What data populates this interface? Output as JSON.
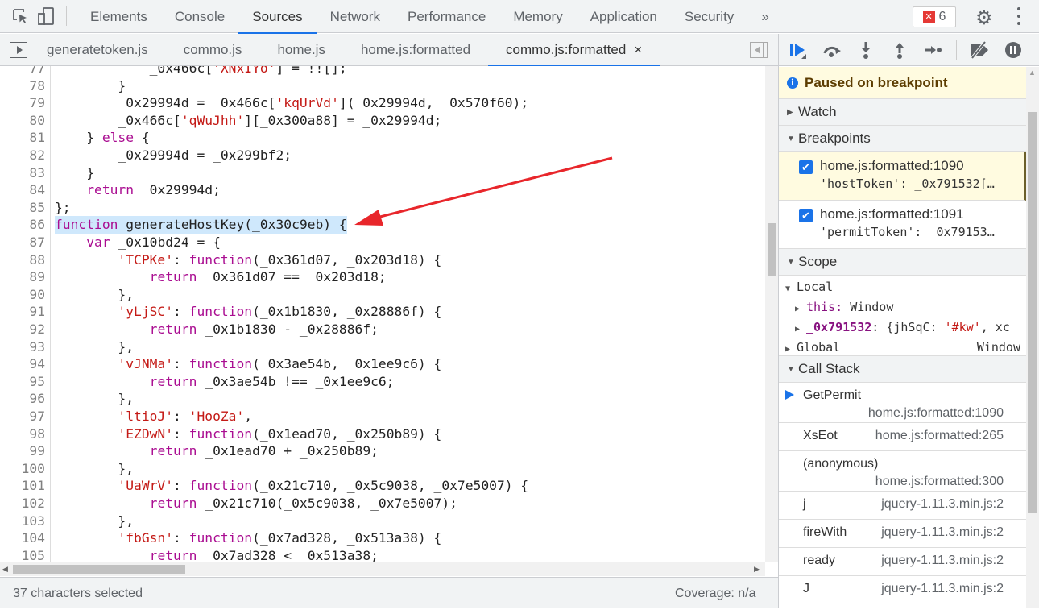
{
  "main_tabs": [
    "Elements",
    "Console",
    "Sources",
    "Network",
    "Performance",
    "Memory",
    "Application",
    "Security"
  ],
  "active_main_tab": "Sources",
  "more_tabs": "»",
  "error_count": "6",
  "file_tabs": [
    "generatetoken.js",
    "commo.js",
    "home.js",
    "home.js:formatted",
    "commo.js:formatted"
  ],
  "active_file_tab": "commo.js:formatted",
  "close_glyph": "×",
  "code_lines": [
    {
      "n": "77",
      "t": [
        [
          "p",
          "            _0x466c["
        ],
        [
          "s",
          "'XNxIYo'"
        ],
        [
          "p",
          "] = !![];"
        ]
      ]
    },
    {
      "n": "78",
      "t": [
        [
          "p",
          "        }"
        ]
      ]
    },
    {
      "n": "79",
      "t": [
        [
          "p",
          "        _0x29994d = _0x466c["
        ],
        [
          "s",
          "'kqUrVd'"
        ],
        [
          "p",
          "](_0x29994d, _0x570f60);"
        ]
      ]
    },
    {
      "n": "80",
      "t": [
        [
          "p",
          "        _0x466c["
        ],
        [
          "s",
          "'qWuJhh'"
        ],
        [
          "p",
          "][_0x300a88] = _0x29994d;"
        ]
      ]
    },
    {
      "n": "81",
      "t": [
        [
          "p",
          "    } "
        ],
        [
          "k",
          "else"
        ],
        [
          "p",
          " {"
        ]
      ]
    },
    {
      "n": "82",
      "t": [
        [
          "p",
          "        _0x29994d = _0x299bf2;"
        ]
      ]
    },
    {
      "n": "83",
      "t": [
        [
          "p",
          "    }"
        ]
      ]
    },
    {
      "n": "84",
      "t": [
        [
          "p",
          "    "
        ],
        [
          "k",
          "return"
        ],
        [
          "p",
          " _0x29994d;"
        ]
      ]
    },
    {
      "n": "85",
      "t": [
        [
          "p",
          "};"
        ]
      ]
    },
    {
      "n": "86",
      "t": [
        [
          "k",
          "function"
        ],
        [
          "p",
          " generateHostKey(_0x30c9eb) {"
        ]
      ],
      "selected": true
    },
    {
      "n": "87",
      "t": [
        [
          "p",
          "    "
        ],
        [
          "k",
          "var"
        ],
        [
          "p",
          " _0x10bd24 = {"
        ]
      ]
    },
    {
      "n": "88",
      "t": [
        [
          "p",
          "        "
        ],
        [
          "s",
          "'TCPKe'"
        ],
        [
          "p",
          ": "
        ],
        [
          "k",
          "function"
        ],
        [
          "p",
          "(_0x361d07, _0x203d18) {"
        ]
      ]
    },
    {
      "n": "89",
      "t": [
        [
          "p",
          "            "
        ],
        [
          "k",
          "return"
        ],
        [
          "p",
          " _0x361d07 == _0x203d18;"
        ]
      ]
    },
    {
      "n": "90",
      "t": [
        [
          "p",
          "        },"
        ]
      ]
    },
    {
      "n": "91",
      "t": [
        [
          "p",
          "        "
        ],
        [
          "s",
          "'yLjSC'"
        ],
        [
          "p",
          ": "
        ],
        [
          "k",
          "function"
        ],
        [
          "p",
          "(_0x1b1830, _0x28886f) {"
        ]
      ]
    },
    {
      "n": "92",
      "t": [
        [
          "p",
          "            "
        ],
        [
          "k",
          "return"
        ],
        [
          "p",
          " _0x1b1830 - _0x28886f;"
        ]
      ]
    },
    {
      "n": "93",
      "t": [
        [
          "p",
          "        },"
        ]
      ]
    },
    {
      "n": "94",
      "t": [
        [
          "p",
          "        "
        ],
        [
          "s",
          "'vJNMa'"
        ],
        [
          "p",
          ": "
        ],
        [
          "k",
          "function"
        ],
        [
          "p",
          "(_0x3ae54b, _0x1ee9c6) {"
        ]
      ]
    },
    {
      "n": "95",
      "t": [
        [
          "p",
          "            "
        ],
        [
          "k",
          "return"
        ],
        [
          "p",
          " _0x3ae54b !== _0x1ee9c6;"
        ]
      ]
    },
    {
      "n": "96",
      "t": [
        [
          "p",
          "        },"
        ]
      ]
    },
    {
      "n": "97",
      "t": [
        [
          "p",
          "        "
        ],
        [
          "s",
          "'ltioJ'"
        ],
        [
          "p",
          ": "
        ],
        [
          "s",
          "'HooZa'"
        ],
        [
          "p",
          ","
        ]
      ]
    },
    {
      "n": "98",
      "t": [
        [
          "p",
          "        "
        ],
        [
          "s",
          "'EZDwN'"
        ],
        [
          "p",
          ": "
        ],
        [
          "k",
          "function"
        ],
        [
          "p",
          "(_0x1ead70, _0x250b89) {"
        ]
      ]
    },
    {
      "n": "99",
      "t": [
        [
          "p",
          "            "
        ],
        [
          "k",
          "return"
        ],
        [
          "p",
          " _0x1ead70 + _0x250b89;"
        ]
      ]
    },
    {
      "n": "100",
      "t": [
        [
          "p",
          "        },"
        ]
      ]
    },
    {
      "n": "101",
      "t": [
        [
          "p",
          "        "
        ],
        [
          "s",
          "'UaWrV'"
        ],
        [
          "p",
          ": "
        ],
        [
          "k",
          "function"
        ],
        [
          "p",
          "(_0x21c710, _0x5c9038, _0x7e5007) {"
        ]
      ]
    },
    {
      "n": "102",
      "t": [
        [
          "p",
          "            "
        ],
        [
          "k",
          "return"
        ],
        [
          "p",
          " _0x21c710(_0x5c9038, _0x7e5007);"
        ]
      ]
    },
    {
      "n": "103",
      "t": [
        [
          "p",
          "        },"
        ]
      ]
    },
    {
      "n": "104",
      "t": [
        [
          "p",
          "        "
        ],
        [
          "s",
          "'fbGsn'"
        ],
        [
          "p",
          ": "
        ],
        [
          "k",
          "function"
        ],
        [
          "p",
          "(_0x7ad328, _0x513a38) {"
        ]
      ]
    },
    {
      "n": "105",
      "t": [
        [
          "p",
          "            "
        ],
        [
          "k",
          "return"
        ],
        [
          "p",
          " _0x7ad328 < _0x513a38;"
        ]
      ]
    }
  ],
  "status": {
    "selection": "37 characters selected",
    "coverage": "Coverage: n/a"
  },
  "debugger": {
    "paused": "Paused on breakpoint",
    "watch": "Watch",
    "breakpoints_title": "Breakpoints",
    "breakpoints": [
      {
        "file": "home.js:formatted:1090",
        "code": "'hostToken': _0x791532[…",
        "checked": true
      },
      {
        "file": "home.js:formatted:1091",
        "code": "'permitToken': _0x79153…",
        "checked": true
      }
    ],
    "scope_title": "Scope",
    "local": "Local",
    "this_key": "this:",
    "this_val": "Window",
    "var_key": "_0x791532",
    "var_open": ": {jhSqC: ",
    "var_str": "'#kw'",
    "var_rest": ", xc",
    "global": "Global",
    "global_val": "Window",
    "callstack_title": "Call Stack",
    "callstack": [
      {
        "fn": "GetPermit",
        "loc": "home.js:formatted:1090",
        "current": true
      },
      {
        "fn": "XsEot",
        "loc": "home.js:formatted:265"
      },
      {
        "fn": "(anonymous)",
        "loc": "home.js:formatted:300"
      },
      {
        "fn": "j",
        "loc": "jquery-1.11.3.min.js:2"
      },
      {
        "fn": "fireWith",
        "loc": "jquery-1.11.3.min.js:2"
      },
      {
        "fn": "ready",
        "loc": "jquery-1.11.3.min.js:2"
      },
      {
        "fn": "J",
        "loc": "jquery-1.11.3.min.js:2"
      }
    ]
  },
  "colors": {
    "accent": "#1a73e8",
    "keyword": "#aa0d91",
    "string": "#c41a16",
    "arrow": "#e8262b",
    "selection": "#cfe8fc"
  }
}
